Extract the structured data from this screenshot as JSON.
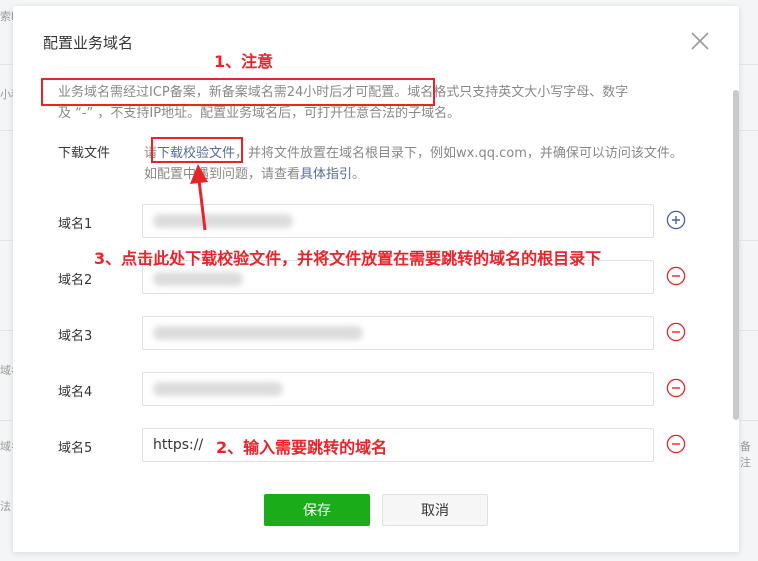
{
  "background": {
    "texts": [
      "索Ⅲ",
      "小程",
      "域名",
      "备注",
      "法"
    ]
  },
  "dialog": {
    "title": "配置业务域名",
    "notice_line1": "业务域名需经过ICP备案，新备案域名需24小时后才可配置。域名格式只支持英文大小写字母、数字",
    "notice_line2": "及 “-” ，不支持IP地址。配置业务域名后，可打开任意合法的子域名。",
    "download": {
      "label": "下载文件",
      "prefix": "请",
      "link": "下载校验文件",
      "middle": "，并将文件放置在域名根目录下，例如wx.qq.com，并确保可以访问该文件。如配置中遇到问题，请查看",
      "guide_link": "具体指引",
      "suffix": "。"
    },
    "fields": [
      {
        "label": "域名1",
        "value": "",
        "action": "add"
      },
      {
        "label": "域名2",
        "value": "",
        "action": "remove"
      },
      {
        "label": "域名3",
        "value": "",
        "action": "remove"
      },
      {
        "label": "域名4",
        "value": "",
        "action": "remove"
      },
      {
        "label": "域名5",
        "value": "https://",
        "action": "remove"
      }
    ],
    "save_label": "保存",
    "cancel_label": "取消"
  },
  "annotations": {
    "note1": "1、注意",
    "note2": "2、输入需要跳转的域名",
    "note3": "3、点击此处下载校验文件，并将文件放置在需要跳转的域名的根目录下"
  },
  "colors": {
    "accent_green": "#1aad19",
    "link_blue": "#576b95",
    "annotation_red": "#e8242a",
    "add_icon": "#4a5fa0",
    "remove_icon": "#e8242a"
  }
}
